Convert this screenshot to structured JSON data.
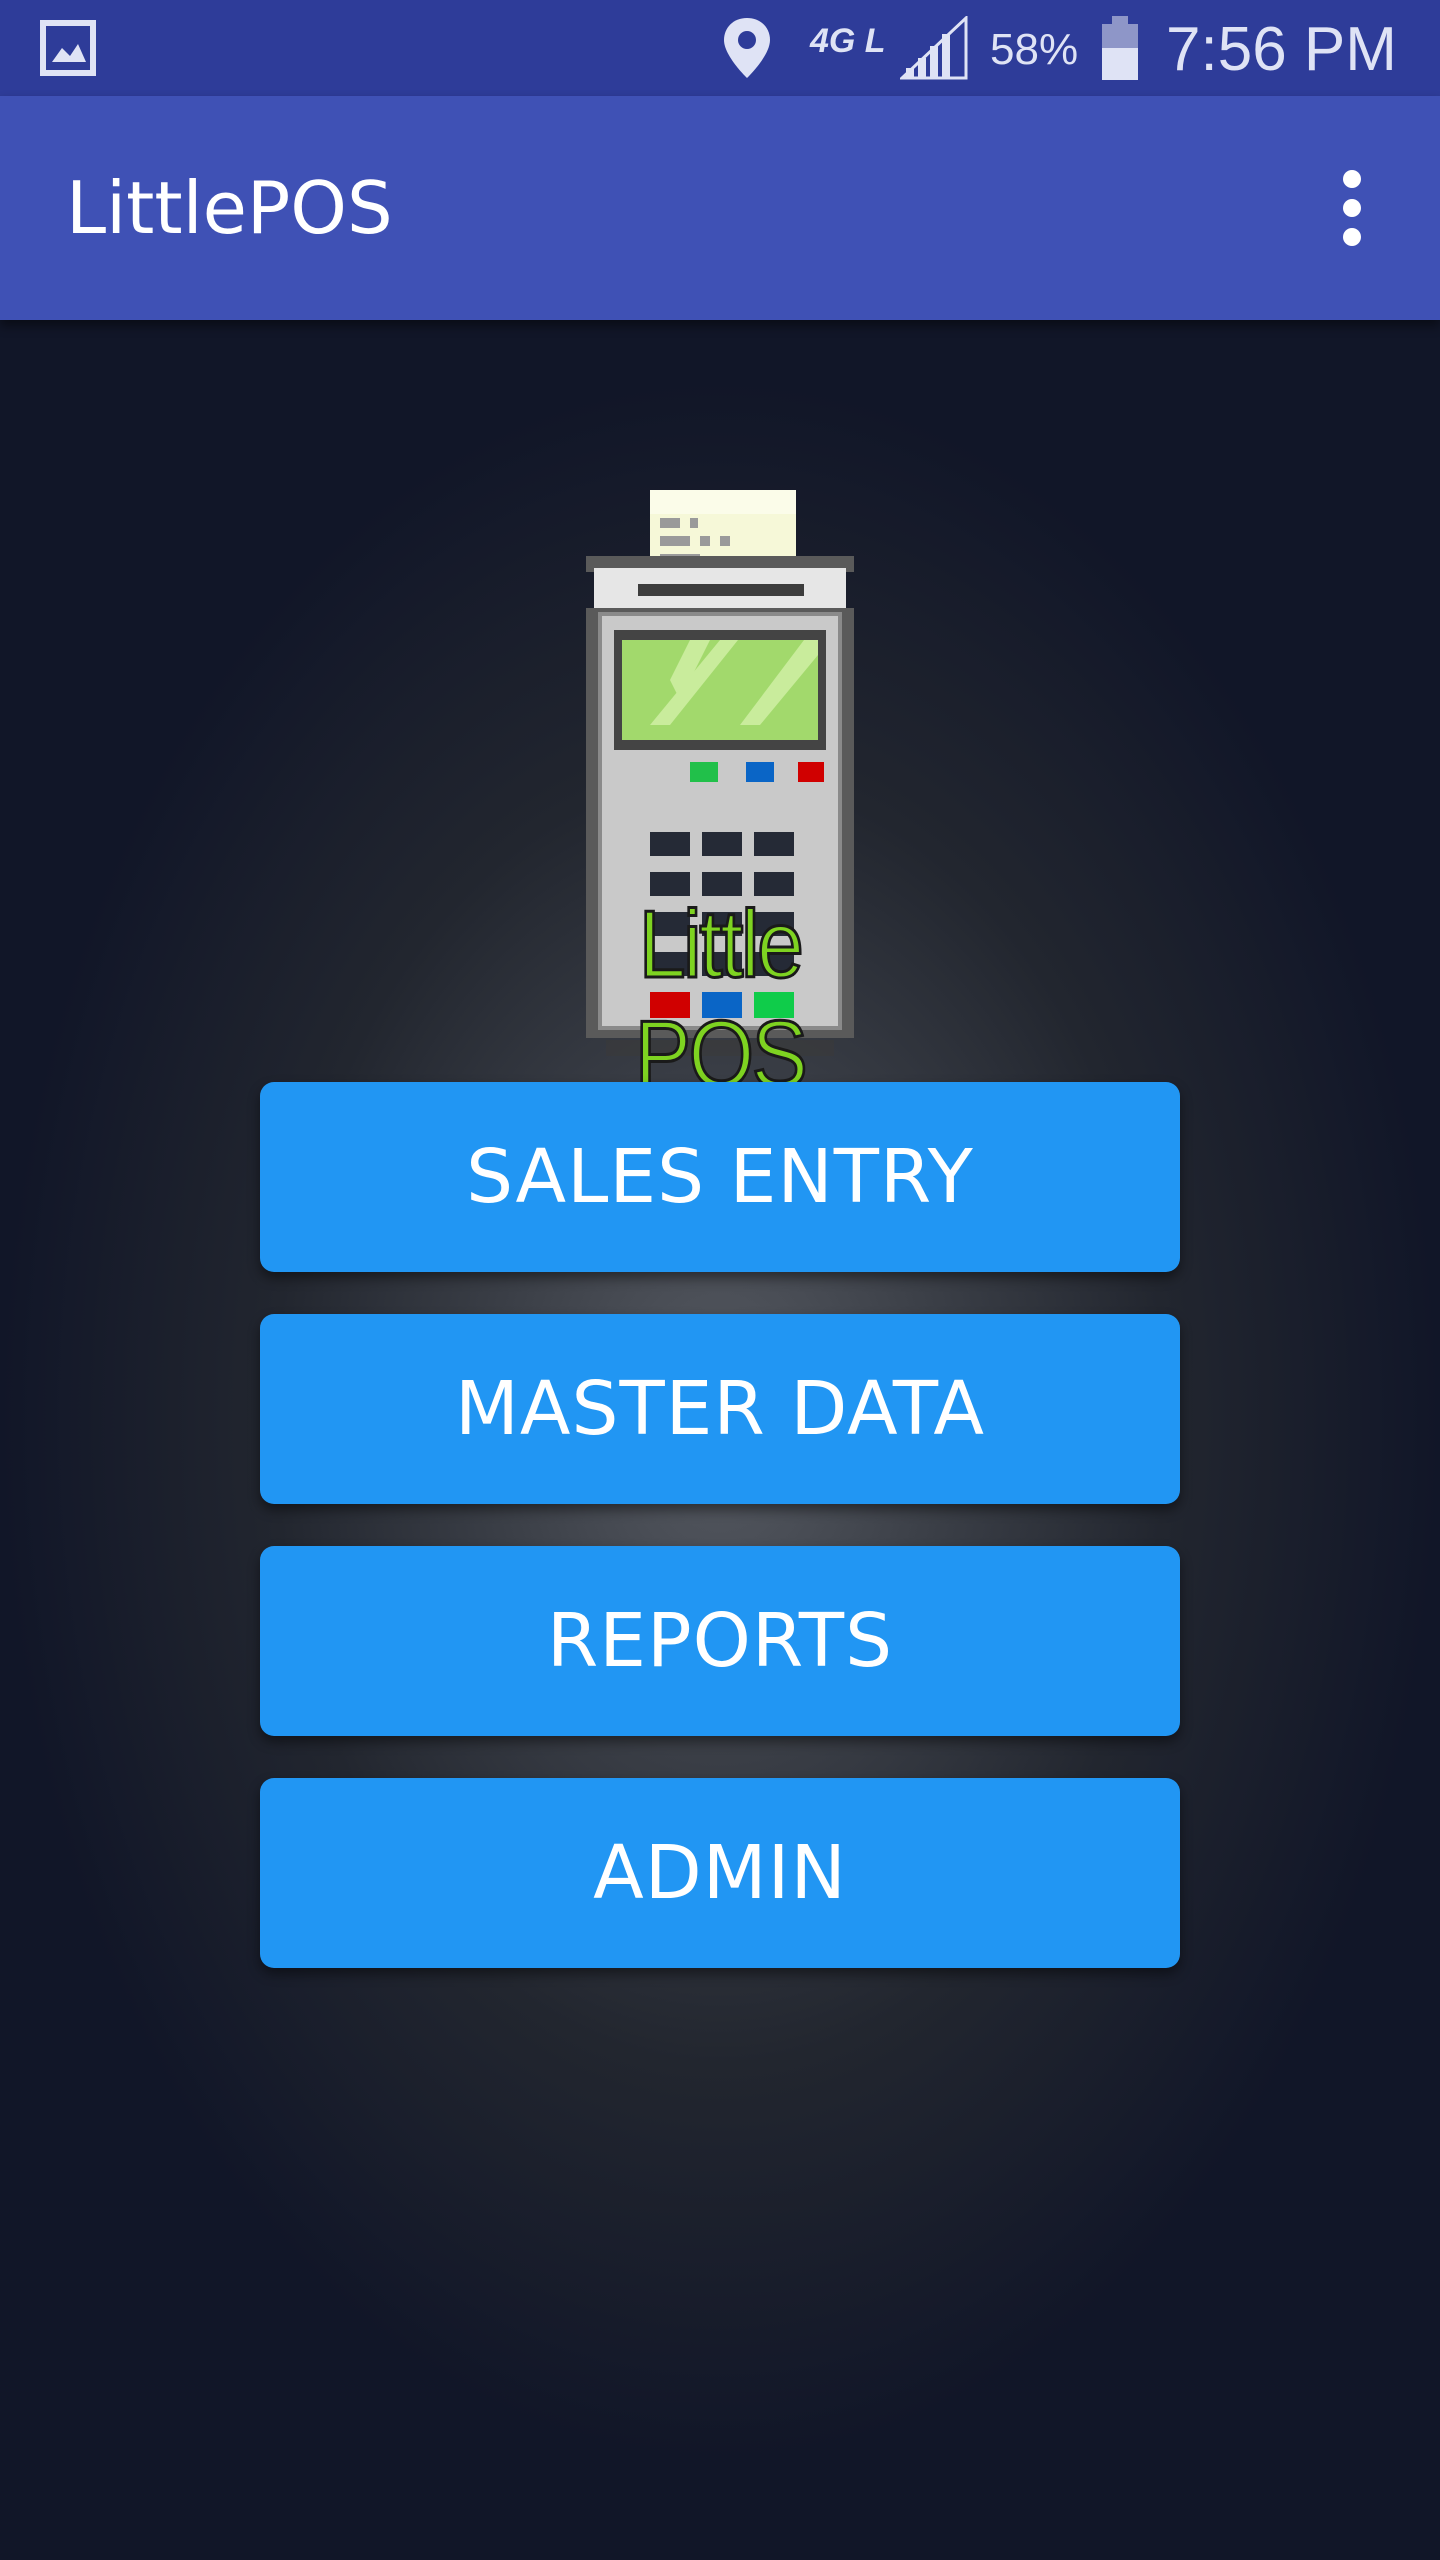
{
  "status_bar": {
    "battery_percent": "58%",
    "time": "7:56 PM",
    "icons": [
      "gallery-icon",
      "location-icon",
      "lte-icon",
      "signal-icon",
      "battery-icon"
    ],
    "network_label": "4G LTE"
  },
  "app_bar": {
    "title": "LittlePOS",
    "menu_icon": "overflow-menu-icon"
  },
  "logo": {
    "text": "Little POS"
  },
  "buttons": {
    "sales_entry": "SALES ENTRY",
    "master_data": "MASTER DATA",
    "reports": "REPORTS",
    "admin": "ADMIN"
  },
  "colors": {
    "status_bar": "#2e3c99",
    "app_bar": "#3f51b5",
    "button": "#2196f3",
    "background": "#111628"
  }
}
